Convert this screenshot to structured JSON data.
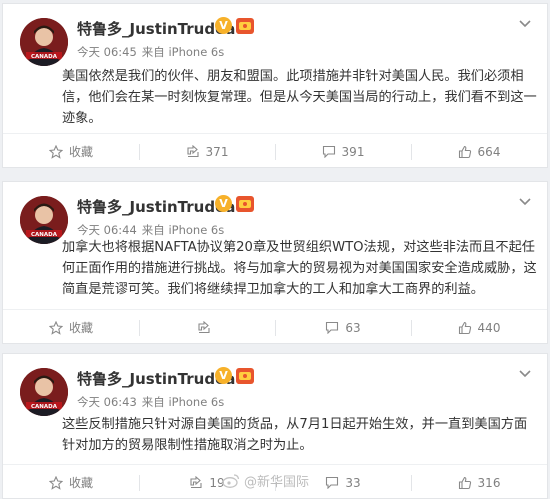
{
  "posts": [
    {
      "author": "特鲁多_JustinTrudeau",
      "time": "今天 06:45",
      "source": "来自 iPhone 6s",
      "avatar_text": "CANADA",
      "text": "美国依然是我们的伙伴、朋友和盟国。此项措施并非针对美国人民。我们必须相信，他们会在某一时刻恢复常理。但是从今天美国当局的行动上，我们看不到这一迹象。",
      "actions": {
        "favorite": "收藏",
        "repost": "371",
        "comment": "391",
        "like": "664"
      }
    },
    {
      "author": "特鲁多_JustinTrudeau",
      "time": "今天 06:44",
      "source": "来自 iPhone 6s",
      "avatar_text": "CANADA",
      "text": "加拿大也将根据NAFTA协议第20章及世贸组织WTO法规，对这些非法而且不起任何正面作用的措施进行挑战。将与加拿大的贸易视为对美国国家安全造成威胁，这简直是荒谬可笑。我们将继续捍卫加拿大的工人和加拿大工商界的利益。",
      "actions": {
        "favorite": "收藏",
        "repost": "",
        "comment": "63",
        "like": "440"
      }
    },
    {
      "author": "特鲁多_JustinTrudeau",
      "time": "今天 06:43",
      "source": "来自 iPhone 6s",
      "avatar_text": "CANADA",
      "text": "这些反制措施只针对源自美国的货品，从7月1日起开始生效，并一直到美国方面针对加方的贸易限制性措施取消之时为止。",
      "actions": {
        "favorite": "收藏",
        "repost": "19",
        "comment": "33",
        "like": "316"
      }
    }
  ],
  "watermark": "@新华国际",
  "colors": {
    "accent_gold": "#f7b12a",
    "text": "#333333",
    "meta": "#808080",
    "background": "#eef0f3"
  },
  "icons": [
    "chevron-down-icon",
    "star-icon",
    "repost-icon",
    "comment-icon",
    "like-icon",
    "verified-v-icon",
    "rank-badge-icon",
    "weibo-logo-icon"
  ]
}
